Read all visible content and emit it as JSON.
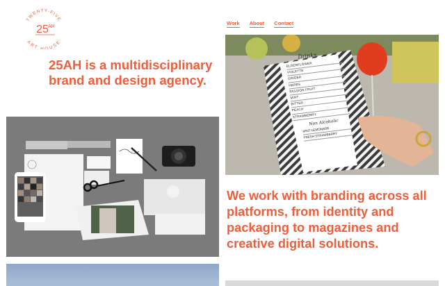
{
  "brand": {
    "logo_top_text": "TWENTY-FIVE",
    "logo_bottom_text": "ART HOUSE",
    "logo_mark": "25",
    "logo_mark_sup": "AH",
    "tagline": "25AH is a multidisciplinary brand and design agency."
  },
  "nav": {
    "items": [
      {
        "label": "Work"
      },
      {
        "label": "About"
      },
      {
        "label": "Contact"
      }
    ]
  },
  "drinks_menu": {
    "title": "Drinks",
    "items": [
      "ELDERFLOWER",
      "VIOLETTE",
      "GINGER",
      "HERBS",
      "PASSION FRUIT",
      "MINT",
      "BITTER",
      "PEACH",
      "STRAWBERRY"
    ],
    "subtitle": "Non Alcoholic",
    "non_alcoholic": [
      "MINT LEMONADE",
      "FRESH STRAWBERRY"
    ]
  },
  "statement": "We work with branding across all platforms, from identity and packaging to magazines and creative digital solutions.",
  "colors": {
    "accent": "#ef5d3a",
    "stationery_bg": "#7b7b7b"
  }
}
